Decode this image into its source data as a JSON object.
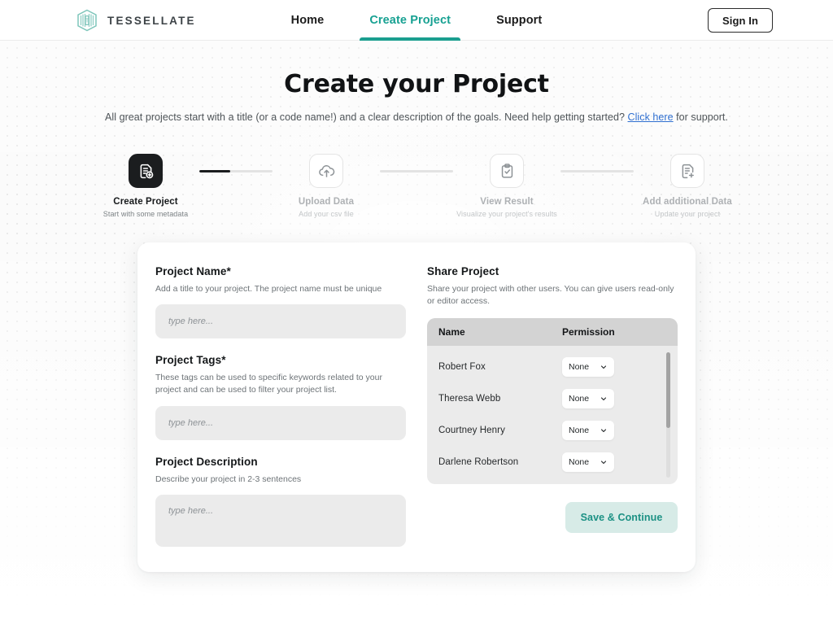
{
  "brand": {
    "name": "TESSELLATE",
    "logo_icon": "hexagon-stripes-logo",
    "color": "#7fc6bb"
  },
  "nav": {
    "items": [
      {
        "label": "Home",
        "active": false
      },
      {
        "label": "Create Project",
        "active": true
      },
      {
        "label": "Support",
        "active": false
      }
    ],
    "active_color": "#17a192",
    "signin_label": "Sign In"
  },
  "hero": {
    "title": "Create your Project",
    "subtitle_before": "All great projects start with a title (or a code name!) and a clear description of the goals. Need help getting started? ",
    "subtitle_link": "Click here",
    "subtitle_after": " for support."
  },
  "stepper": {
    "steps": [
      {
        "label": "Create Project",
        "desc": "Start with some metadata",
        "icon": "document-plus-icon",
        "state": "current"
      },
      {
        "label": "Upload Data",
        "desc": "Add your csv file",
        "icon": "cloud-upload-icon",
        "state": "upcoming"
      },
      {
        "label": "View Result",
        "desc": "Visualize your project's results",
        "icon": "clipboard-check-icon",
        "state": "upcoming"
      },
      {
        "label": "Add additional Data",
        "desc": "Update your project",
        "icon": "document-plus-icon",
        "state": "upcoming"
      }
    ]
  },
  "form": {
    "project_name": {
      "label": "Project Name*",
      "help": "Add a title to your project. The project name must be unique",
      "value": "",
      "placeholder": "type here..."
    },
    "project_tags": {
      "label": "Project Tags*",
      "help": "These tags can be used to specific keywords related to your project and can be used to filter your project list.",
      "value": "",
      "placeholder": "type here..."
    },
    "project_description": {
      "label": "Project Description",
      "help": "Describe your project in 2-3 sentences",
      "value": "",
      "placeholder": "type here..."
    }
  },
  "share": {
    "title": "Share Project",
    "help": "Share your project with other users. You can give users read-only or editor access.",
    "columns": [
      "Name",
      "Permission"
    ],
    "rows": [
      {
        "name": "Robert Fox",
        "permission": "None"
      },
      {
        "name": "Theresa Webb",
        "permission": "None"
      },
      {
        "name": "Courtney Henry",
        "permission": "None"
      },
      {
        "name": "Darlene Robertson",
        "permission": "None"
      }
    ],
    "scroll_thumb_percent": 60
  },
  "actions": {
    "save_label": "Save & Continue",
    "save_bg": "#d7ebe7",
    "save_fg": "#1c9184"
  }
}
